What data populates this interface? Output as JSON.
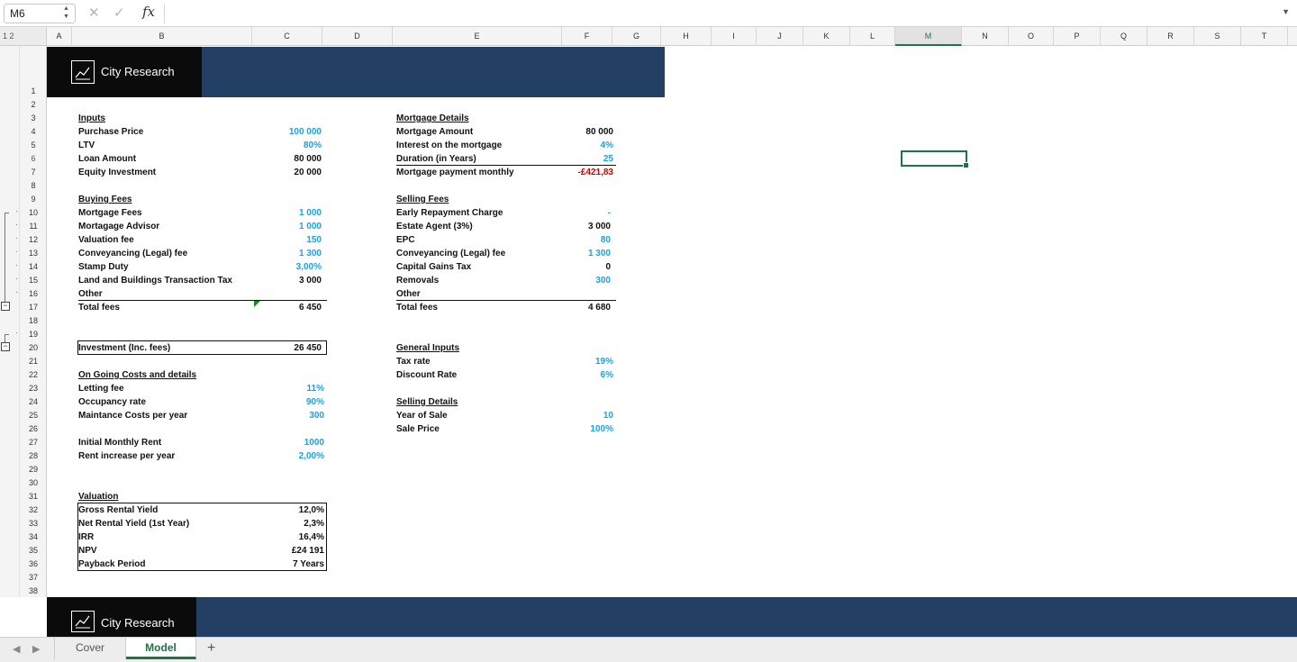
{
  "formula_bar": {
    "name_box": "M6",
    "formula": "",
    "fx_label": "fx"
  },
  "outline_levels": [
    "1",
    "2"
  ],
  "columns": [
    "A",
    "B",
    "C",
    "D",
    "E",
    "F",
    "G",
    "H",
    "I",
    "J",
    "K",
    "L",
    "M",
    "N",
    "O",
    "P",
    "Q",
    "R",
    "S",
    "T"
  ],
  "rows": [
    "1",
    "2",
    "3",
    "4",
    "5",
    "6",
    "7",
    "8",
    "9",
    "10",
    "11",
    "12",
    "13",
    "14",
    "15",
    "16",
    "17",
    "18",
    "19",
    "20",
    "21",
    "22",
    "23",
    "24",
    "25",
    "26",
    "27",
    "28",
    "29",
    "30",
    "31",
    "32",
    "33",
    "34",
    "35",
    "36",
    "37",
    "38"
  ],
  "selected_cell": {
    "column": "M",
    "row": "6"
  },
  "brand": {
    "name": "City Research",
    "banner_color": "#233f63",
    "logo_bg": "#0b0b0b"
  },
  "inputs": {
    "header": "Inputs",
    "rows": [
      {
        "label": "Purchase Price",
        "value": "100 000",
        "style": "blue"
      },
      {
        "label": "LTV",
        "value": "80%",
        "style": "blue"
      },
      {
        "label": "Loan Amount",
        "value": "80 000",
        "style": "black"
      },
      {
        "label": "Equity Investment",
        "value": "20 000",
        "style": "black"
      }
    ]
  },
  "mortgage": {
    "header": "Mortgage Details",
    "rows": [
      {
        "label": "Mortgage Amount",
        "value": "80 000",
        "style": "black"
      },
      {
        "label": "Interest on the mortgage",
        "value": "4%",
        "style": "blue"
      },
      {
        "label": "Duration (in Years)",
        "value": "25",
        "style": "blue"
      },
      {
        "label": "Mortgage payment monthly",
        "value": "-£421,83",
        "style": "red"
      }
    ]
  },
  "buying_fees": {
    "header": "Buying Fees",
    "rows": [
      {
        "label": "Mortgage Fees",
        "value": "1 000",
        "style": "blue"
      },
      {
        "label": "Mortagage Advisor",
        "value": "1 000",
        "style": "blue"
      },
      {
        "label": "Valuation fee",
        "value": "150",
        "style": "blue"
      },
      {
        "label": "Conveyancing (Legal) fee",
        "value": "1 300",
        "style": "blue"
      },
      {
        "label": "Stamp Duty",
        "value": "3,00%",
        "style": "blue"
      },
      {
        "label": "Land and Buildings Transaction Tax",
        "value": "3 000",
        "style": "black"
      },
      {
        "label": "Other",
        "value": "",
        "style": "black"
      }
    ],
    "total_label": "Total fees",
    "total_value": "6 450"
  },
  "selling_fees": {
    "header": "Selling Fees",
    "rows": [
      {
        "label": "Early Repayment Charge",
        "value": "-",
        "style": "blue"
      },
      {
        "label": "Estate Agent (3%)",
        "value": "3 000",
        "style": "black"
      },
      {
        "label": "EPC",
        "value": "80",
        "style": "blue"
      },
      {
        "label": "Conveyancing (Legal) fee",
        "value": "1 300",
        "style": "blue"
      },
      {
        "label": "Capital Gains Tax",
        "value": "0",
        "style": "black"
      },
      {
        "label": "Removals",
        "value": "300",
        "style": "blue"
      },
      {
        "label": "Other",
        "value": "",
        "style": "black"
      }
    ],
    "total_label": "Total fees",
    "total_value": "4 680"
  },
  "investment": {
    "label": "Investment (Inc. fees)",
    "value": "26 450"
  },
  "ongoing": {
    "header": "On Going Costs and details",
    "rows": [
      {
        "label": "Letting fee",
        "value": "11%",
        "style": "blue"
      },
      {
        "label": "Occupancy rate",
        "value": "90%",
        "style": "blue"
      },
      {
        "label": "Maintance Costs per year",
        "value": "300",
        "style": "blue"
      }
    ]
  },
  "rent": {
    "rows": [
      {
        "label": "Initial Monthly Rent",
        "value": "1000",
        "style": "blue"
      },
      {
        "label": "Rent increase per year",
        "value": "2,00%",
        "style": "blue"
      }
    ]
  },
  "general_inputs": {
    "header": "General Inputs",
    "rows": [
      {
        "label": "Tax rate",
        "value": "19%",
        "style": "blue"
      },
      {
        "label": "Discount Rate",
        "value": "6%",
        "style": "blue"
      }
    ]
  },
  "selling_details": {
    "header": "Selling Details",
    "rows": [
      {
        "label": "Year of Sale",
        "value": "10",
        "style": "blue"
      },
      {
        "label": "Sale Price",
        "value": "100%",
        "style": "blue"
      }
    ]
  },
  "valuation": {
    "header": "Valuation",
    "rows": [
      {
        "label": "Gross Rental Yield",
        "value": "12,0%"
      },
      {
        "label": "Net Rental Yield (1st Year)",
        "value": "2,3%"
      },
      {
        "label": "IRR",
        "value": "16,4%"
      },
      {
        "label": "NPV",
        "value": "£24 191"
      },
      {
        "label": "Payback Period",
        "value": "7 Years"
      }
    ]
  },
  "sheet_tabs": {
    "tabs": [
      {
        "label": "Cover",
        "active": false
      },
      {
        "label": "Model",
        "active": true
      }
    ],
    "add_label": "+"
  },
  "colors": {
    "input_blue": "#1ba1e2",
    "negative_red": "#d00000",
    "excel_green": "#217346"
  }
}
